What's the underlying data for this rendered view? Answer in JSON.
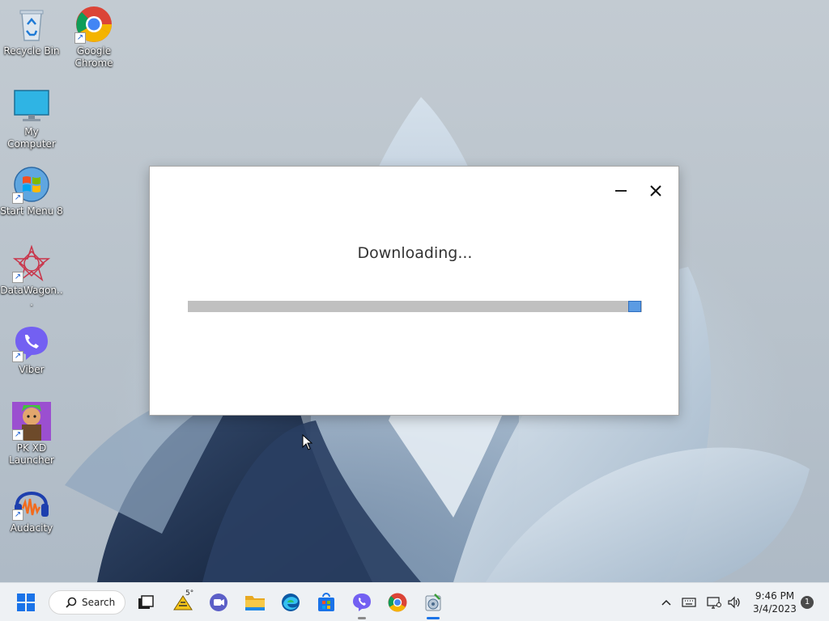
{
  "desktop": {
    "icons": [
      {
        "label": "Recycle Bin",
        "icon": "recycle-bin-icon",
        "shortcut": false
      },
      {
        "label": "Google Chrome",
        "icon": "chrome-icon",
        "shortcut": true
      },
      {
        "label": "My Computer",
        "icon": "monitor-icon",
        "shortcut": false
      },
      {
        "label": "Start Menu 8",
        "icon": "windows-orb-icon",
        "shortcut": true
      },
      {
        "label": "DataWagon...",
        "icon": "datawagon-icon",
        "shortcut": true
      },
      {
        "label": "Viber",
        "icon": "viber-icon",
        "shortcut": true
      },
      {
        "label": "PK XD Launcher",
        "icon": "pkxd-icon",
        "shortcut": true
      },
      {
        "label": "Audacity",
        "icon": "audacity-icon",
        "shortcut": true
      }
    ]
  },
  "dialog": {
    "status": "Downloading...",
    "progress_fraction": 0.97,
    "minimize_icon": "minimize-icon",
    "close_icon": "close-icon",
    "progress_color": "#5b9be3"
  },
  "taskbar": {
    "search_label": "Search",
    "weather_temp": "5°",
    "apps": [
      "start-icon",
      "task-view-icon",
      "weather-icon",
      "teams-icon",
      "file-explorer-icon",
      "edge-icon",
      "store-icon",
      "viber-icon",
      "chrome-icon",
      "installer-icon"
    ],
    "tray": {
      "time": "9:46 PM",
      "date": "3/4/2023",
      "notification_count": "1"
    }
  }
}
